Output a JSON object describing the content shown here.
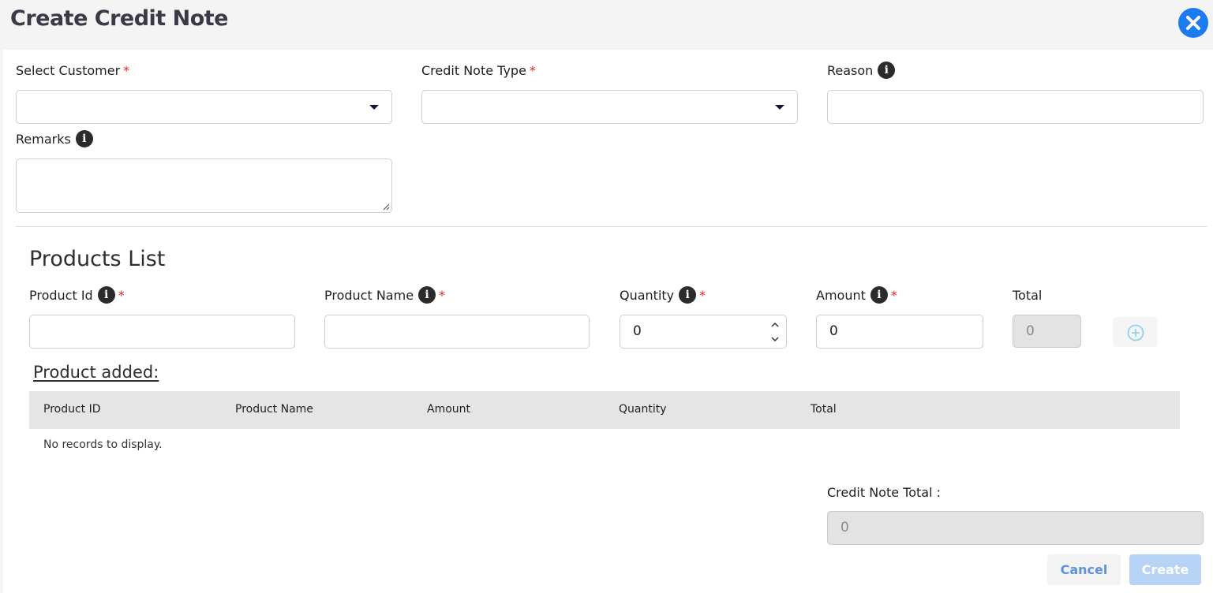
{
  "header": {
    "title": "Create Credit Note",
    "close_icon": "close-icon"
  },
  "form": {
    "select_customer": {
      "label": "Select Customer",
      "required": "*",
      "value": ""
    },
    "credit_note_type": {
      "label": "Credit Note Type",
      "required": "*",
      "value": ""
    },
    "reason": {
      "label": "Reason",
      "info": "i",
      "value": ""
    },
    "remarks": {
      "label": "Remarks",
      "info": "i",
      "value": ""
    }
  },
  "products": {
    "heading": "Products List",
    "product_id": {
      "label": "Product Id",
      "info": "i",
      "required": "*",
      "value": ""
    },
    "product_name": {
      "label": "Product Name",
      "info": "i",
      "required": "*",
      "value": ""
    },
    "quantity": {
      "label": "Quantity",
      "info": "i",
      "required": "*",
      "value": "0"
    },
    "amount": {
      "label": "Amount",
      "info": "i",
      "required": "*",
      "value": "0"
    },
    "total": {
      "label": "Total",
      "value": "0"
    },
    "add_icon": "plus-circle-icon"
  },
  "added": {
    "heading": "Product added:",
    "columns": [
      "Product ID",
      "Product Name",
      "Amount",
      "Quantity",
      "Total"
    ],
    "empty_text": "No records to display."
  },
  "summary": {
    "label": "Credit Note Total :",
    "value": "0"
  },
  "actions": {
    "cancel": "Cancel",
    "create": "Create"
  },
  "colors": {
    "accent": "#1a7cf0",
    "required": "#e02424",
    "disabled_bg": "#e3e3e3",
    "create_disabled": "#b7d3f5"
  }
}
